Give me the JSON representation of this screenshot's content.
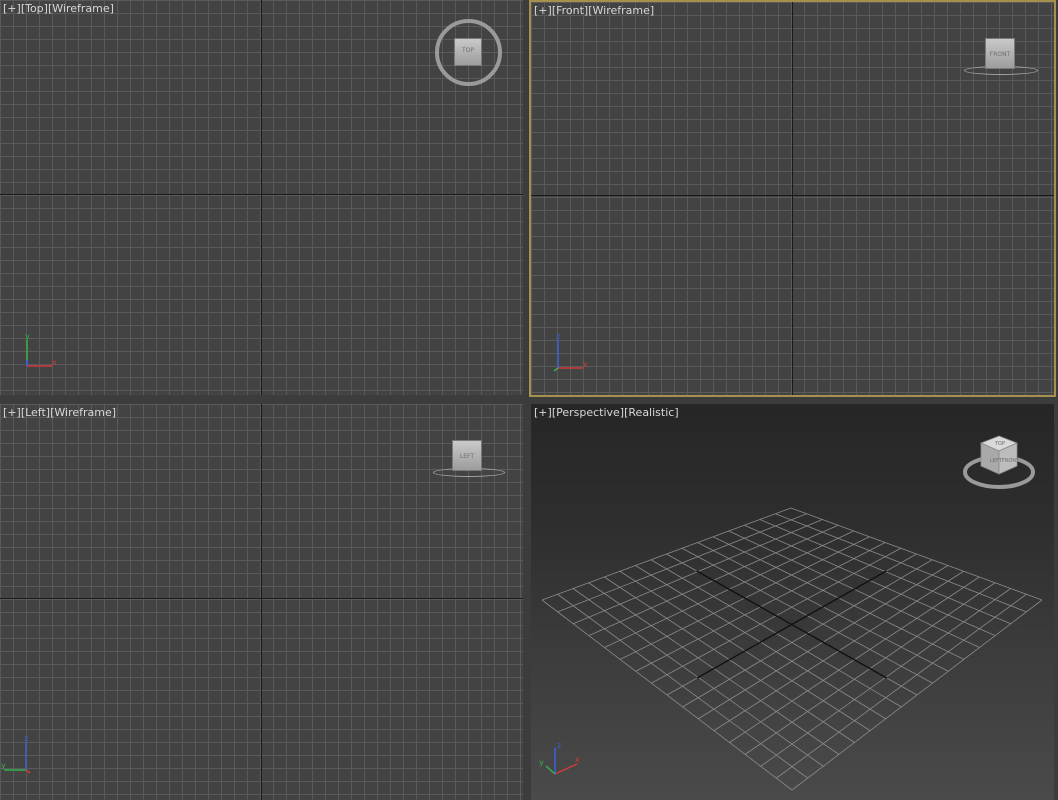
{
  "viewports": [
    {
      "id": "top",
      "menu": "[+]",
      "view": "[Top]",
      "shading": "[Wireframe]",
      "cube": "TOP"
    },
    {
      "id": "front",
      "menu": "[+]",
      "view": "[Front]",
      "shading": "[Wireframe]",
      "cube": "FRONT"
    },
    {
      "id": "left",
      "menu": "[+]",
      "view": "[Left]",
      "shading": "[Wireframe]",
      "cube": "LEFT"
    },
    {
      "id": "perspective",
      "menu": "[+]",
      "view": "[Perspective]",
      "shading": "[Realistic]",
      "cube_front": "FRONT",
      "cube_left": "LEFT",
      "cube_top": "TOP"
    }
  ],
  "axes": {
    "x": "x",
    "y": "y",
    "z": "z"
  },
  "colors": {
    "active_border": "#a5904e",
    "axis_x": "#d23b3b",
    "axis_y": "#3bb04a",
    "axis_z": "#3a62d8"
  }
}
